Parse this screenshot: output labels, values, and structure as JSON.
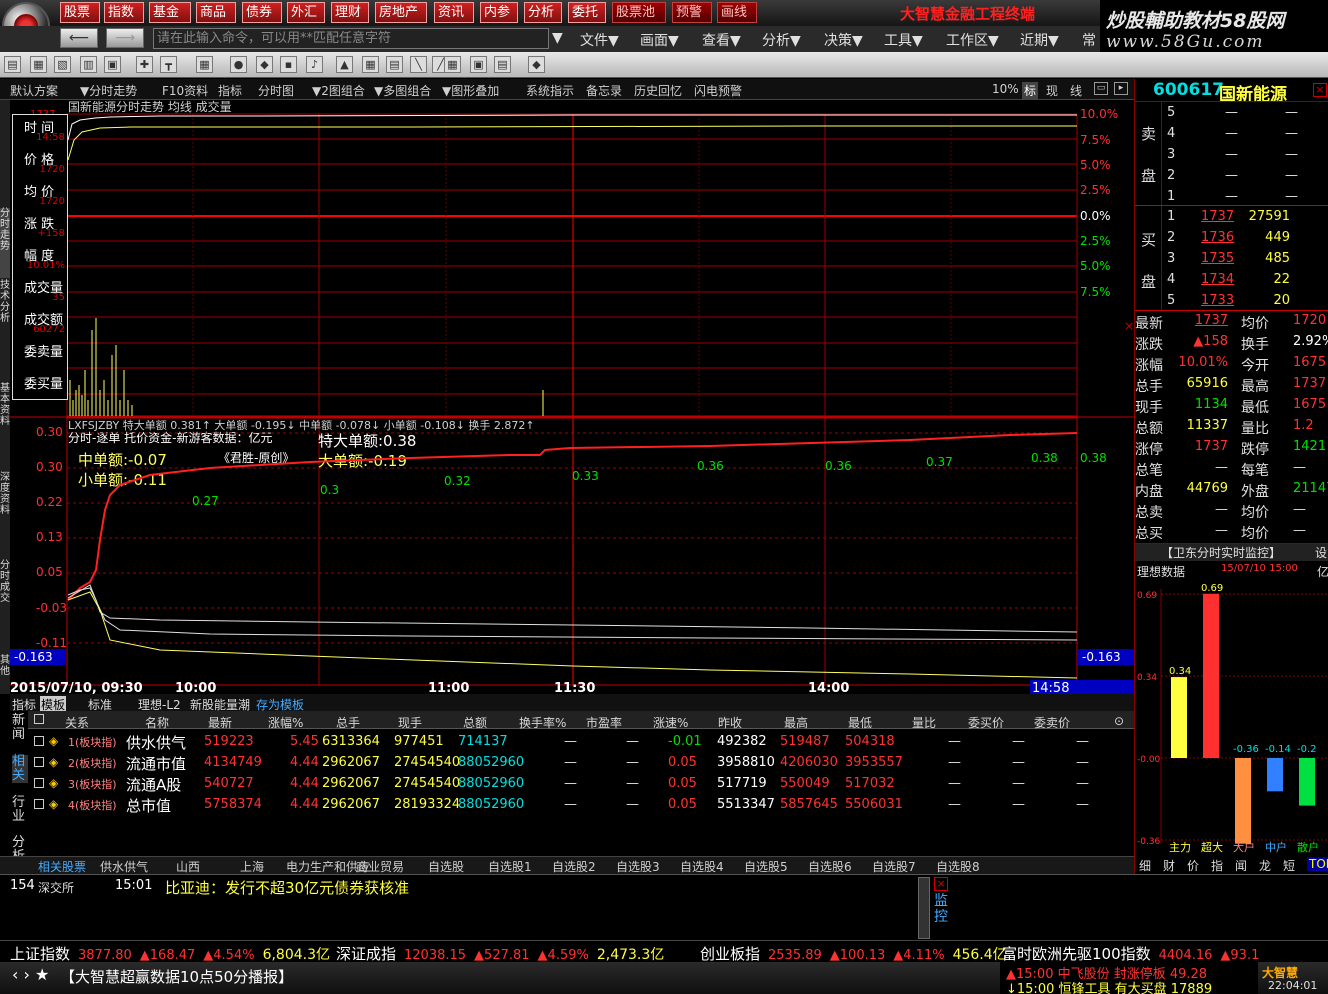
{
  "topmenu": [
    "股票",
    "指数",
    "基金",
    "商品",
    "债券",
    "外汇",
    "理财",
    "房地产",
    "资讯",
    "内参",
    "分析",
    "委托"
  ],
  "topmenu_dark": [
    "股票池",
    "预警",
    "画线"
  ],
  "app_title": "大智慧金融工程终端",
  "brand_line1": "炒股輔助教材58股网",
  "brand_line2": "www.58Gu.com",
  "command_placeholder": "请在此输入命令，可以用**匹配任意字符",
  "menus": [
    "文件▼",
    "画面▼",
    "查看▼",
    "分析▼",
    "决策▼",
    "工具▼",
    "工作区▼",
    "近期▼",
    "常"
  ],
  "tabs": [
    "默认方案",
    "▼分时走势",
    "F10资料",
    "指标",
    "分时图",
    "▼2图组合",
    "▼多图组合",
    "▼图形叠加",
    "系统指示",
    "备忘录",
    "历史回忆",
    "闪电预警"
  ],
  "tabs_right": [
    "10%",
    "标",
    "现",
    "线"
  ],
  "vtabs": [
    "分时走势",
    "技术分析",
    "基本资料",
    "深度资料",
    "分时成交",
    "其他"
  ],
  "chart": {
    "title": "国新能源分时走势 均线 成交量",
    "y_top_label": "1737",
    "right_pct": [
      "10.0%",
      "7.5%",
      "5.0%",
      "2.5%",
      "0.0%",
      "2.5%",
      "5.0%",
      "7.5%"
    ],
    "indicator_line": "LXFSJZBY 特大单额 0.381↑ 大单额 -0.195↓ 中单额 -0.078↓ 小单额 -0.108↓ 换手 2.872↑",
    "indicator_title": "分时-逐单 托价资金-新游客数据：亿元",
    "brand_tag": "《君胜-原创》",
    "labels": {
      "mid": "中单额:-0.07",
      "small": "小单额:-0.11",
      "xl": "特大单额:0.38",
      "large": "大单额:-0.19"
    },
    "point_labels": [
      "0.27",
      "0.3",
      "0.32",
      "0.33",
      "0.36",
      "0.36",
      "0.37",
      "0.38"
    ],
    "left_axis": [
      "0.30",
      "0.30",
      "0.22",
      "0.13",
      "0.05",
      "-0.03",
      "-0.11",
      "-0.163"
    ],
    "right_axis_val": "0.38",
    "right_axis_neg": "-0.163",
    "time_labels": [
      "2015/07/10, 09:30",
      "10:00",
      "11:00",
      "11:30",
      "14:00"
    ],
    "cursor_time": "14:58"
  },
  "infobox": {
    "items": [
      {
        "label": "时 间",
        "value": "14:58"
      },
      {
        "label": "价 格",
        "value": "1720"
      },
      {
        "label": "均 价",
        "value": "1720"
      },
      {
        "label": "涨 跌",
        "value": "+158"
      },
      {
        "label": "幅 度",
        "value": "10.01%"
      },
      {
        "label": "成交量",
        "value": "35"
      },
      {
        "label": "成交额",
        "value": "60272"
      },
      {
        "label": "委卖量",
        "value": ""
      },
      {
        "label": "委买量",
        "value": ""
      }
    ]
  },
  "table": {
    "subtabs": [
      "指标",
      "模板",
      "标准",
      "理想-L2",
      "新股能量潮",
      "存为模板"
    ],
    "headers": [
      "关系",
      "名称",
      "最新",
      "涨幅%",
      "总手",
      "现手",
      "总额",
      "换手率%",
      "市盈率",
      "涨速%",
      "昨收",
      "最高",
      "最低",
      "量比",
      "委买价",
      "委卖价"
    ],
    "rows": [
      {
        "rel": "1(板块指)",
        "name": "供水供气",
        "last": "519223",
        "chg": "5.45",
        "vol": "6313364",
        "cur": "977451",
        "amt": "714137",
        "turn": "—",
        "pe": "—",
        "speed": "-0.01",
        "prev": "492382",
        "high": "519487",
        "low": "504318",
        "ratio": "—",
        "bid": "—",
        "ask": "—"
      },
      {
        "rel": "2(板块指)",
        "name": "流通市值",
        "last": "4134749",
        "chg": "4.44",
        "vol": "2962067",
        "cur": "27454540",
        "amt": "88052960",
        "turn": "—",
        "pe": "—",
        "speed": "0.05",
        "prev": "3958810",
        "high": "4206030",
        "low": "3953557",
        "ratio": "—",
        "bid": "—",
        "ask": "—"
      },
      {
        "rel": "3(板块指)",
        "name": "流通A股",
        "last": "540727",
        "chg": "4.44",
        "vol": "2962067",
        "cur": "27454540",
        "amt": "88052960",
        "turn": "—",
        "pe": "—",
        "speed": "0.05",
        "prev": "517719",
        "high": "550049",
        "low": "517032",
        "ratio": "—",
        "bid": "—",
        "ask": "—"
      },
      {
        "rel": "4(板块指)",
        "name": "总市值",
        "last": "5758374",
        "chg": "4.44",
        "vol": "2962067",
        "cur": "28193324",
        "amt": "88052960",
        "turn": "—",
        "pe": "—",
        "speed": "0.05",
        "prev": "5513347",
        "high": "5857645",
        "low": "5506031",
        "ratio": "—",
        "bid": "—",
        "ask": "—"
      }
    ],
    "side_tabs": [
      "新闻",
      "相关",
      "行业",
      "分析"
    ]
  },
  "bottom_tabs": [
    "相关股票",
    "供水供气",
    "山西",
    "上海",
    "电力生产和供应",
    "商业贸易",
    "自选股",
    "自选股1",
    "自选股2",
    "自选股3",
    "自选股4",
    "自选股5",
    "自选股6",
    "自选股7",
    "自选股8"
  ],
  "news": {
    "count": "154",
    "source": "深交所",
    "time": "15:01",
    "headline": "比亚迪：发行不超30亿元债券获核准",
    "side": [
      "监",
      "控"
    ]
  },
  "ticker": [
    {
      "name": "上证指数",
      "val": "3877.80",
      "chg": "▲168.47",
      "pct": "▲4.54%",
      "amt": "6,804.3亿"
    },
    {
      "name": "深证成指",
      "val": "12038.15",
      "chg": "▲527.81",
      "pct": "▲4.59%",
      "amt": "2,473.3亿"
    },
    {
      "name": "创业板指",
      "val": "2535.89",
      "chg": "▲100.13",
      "pct": "▲4.11%",
      "amt": "456.4亿"
    },
    {
      "name": "富时欧洲先驱100指数",
      "val": "4404.16",
      "chg": "▲93.1",
      "pct": "",
      "amt": ""
    }
  ],
  "bottom": {
    "broadcast": "【大智慧超赢数据10点50分播报】",
    "alert1": "▲15:00 中飞股份 封涨停板 49.28",
    "alert2": "↓15:00 恒锋工具 有大买盘 17889",
    "clock": "22:04:01",
    "logo": "大智慧"
  },
  "rpanel": {
    "code": "600617",
    "name": "国新能源",
    "sell": [
      {
        "n": "5",
        "p": "—",
        "v": "—"
      },
      {
        "n": "4",
        "p": "—",
        "v": "—"
      },
      {
        "n": "3",
        "p": "—",
        "v": "—"
      },
      {
        "n": "2",
        "p": "—",
        "v": "—"
      },
      {
        "n": "1",
        "p": "—",
        "v": "—"
      }
    ],
    "buy": [
      {
        "n": "1",
        "p": "1737",
        "v": "27591"
      },
      {
        "n": "2",
        "p": "1736",
        "v": "449"
      },
      {
        "n": "3",
        "p": "1735",
        "v": "485"
      },
      {
        "n": "4",
        "p": "1734",
        "v": "22"
      },
      {
        "n": "5",
        "p": "1733",
        "v": "20"
      }
    ],
    "sell_label": [
      "卖",
      "盘"
    ],
    "buy_label": [
      "买",
      "盘"
    ],
    "stats": [
      {
        "l1": "最新",
        "v1": "1737",
        "l2": "均价",
        "v2": "1720"
      },
      {
        "l1": "涨跌",
        "v1": "▲158",
        "l2": "换手",
        "v2": "2.92%"
      },
      {
        "l1": "涨幅",
        "v1": "10.01%",
        "l2": "今开",
        "v2": "1675"
      },
      {
        "l1": "总手",
        "v1": "65916",
        "l2": "最高",
        "v2": "1737"
      },
      {
        "l1": "现手",
        "v1": "1134",
        "l2": "最低",
        "v2": "1675"
      },
      {
        "l1": "总额",
        "v1": "11337",
        "l2": "量比",
        "v2": "1.2"
      },
      {
        "l1": "涨停",
        "v1": "1737",
        "l2": "跌停",
        "v2": "1421"
      },
      {
        "l1": "总笔",
        "v1": "—",
        "l2": "每笔",
        "v2": "—"
      },
      {
        "l1": "内盘",
        "v1": "44769",
        "l2": "外盘",
        "v2": "21147"
      },
      {
        "l1": "总卖",
        "v1": "—",
        "l2": "均价",
        "v2": "—"
      },
      {
        "l1": "总买",
        "v1": "—",
        "l2": "均价",
        "v2": "—"
      }
    ],
    "monitor_title": "【卫东分时实时监控】",
    "monitor_btn": "设",
    "monitor_label": "理想数据",
    "monitor_date": "15/07/10 15:00",
    "monitor_unit": "亿",
    "bar_axis": [
      "0.69",
      "0.34",
      "-0.00",
      "-0.36"
    ],
    "bars": [
      {
        "name": "主力",
        "value": 0.34,
        "color": "#ffff40"
      },
      {
        "name": "超大",
        "value": 0.69,
        "color": "#ff3030"
      },
      {
        "name": "大户",
        "value": -0.36,
        "color": "#ff9040"
      },
      {
        "name": "中户",
        "value": -0.14,
        "color": "#3080ff"
      },
      {
        "name": "散户",
        "value": -0.2,
        "color": "#00e040"
      }
    ],
    "bottom_tabs": [
      "细",
      "财",
      "价",
      "指",
      "闻",
      "龙",
      "短",
      "TOP"
    ]
  }
}
